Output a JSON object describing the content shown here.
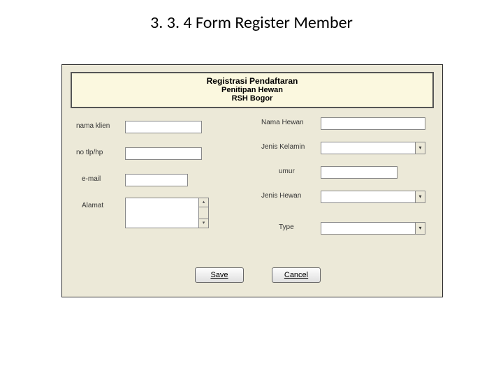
{
  "page": {
    "title": "3. 3. 4 Form Register Member"
  },
  "header": {
    "line1": "Registrasi Pendaftaran",
    "line2": "Penitipan Hewan",
    "line3": "RSH Bogor"
  },
  "left": {
    "nama_klien_label": "nama klien",
    "nama_klien": "",
    "no_tlp_label": "no tlp/hp",
    "no_tlp": "",
    "email_label": "e-mail",
    "email": "",
    "alamat_label": "Alamat",
    "alamat": ""
  },
  "right": {
    "nama_hewan_label": "Nama Hewan",
    "nama_hewan": "",
    "jenis_kelamin_label": "Jenis Kelamin",
    "jenis_kelamin": "",
    "umur_label": "umur",
    "umur": "",
    "jenis_hewan_label": "Jenis Hewan",
    "jenis_hewan": "",
    "type_label": "Type",
    "type": ""
  },
  "buttons": {
    "save": "Save",
    "cancel": "Cancel"
  }
}
